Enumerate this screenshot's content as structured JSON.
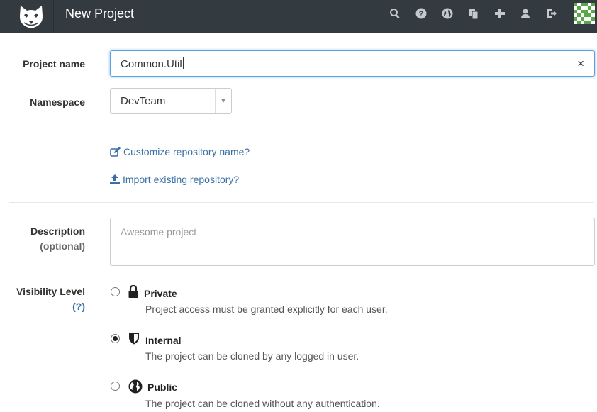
{
  "header": {
    "title": "New Project",
    "icons": [
      "search-icon",
      "help-icon",
      "globe-icon",
      "copy-icon",
      "plus-icon",
      "user-icon",
      "sign-out-icon"
    ],
    "avatar": "avatar"
  },
  "form": {
    "project_name": {
      "label": "Project name",
      "value": "Common.Util",
      "clear": "×"
    },
    "namespace": {
      "label": "Namespace",
      "value": "DevTeam",
      "arrow": "▼"
    },
    "links": {
      "customize": "Customize repository name?",
      "import": "Import existing repository?"
    },
    "description": {
      "label": "Description",
      "sublabel": "(optional)",
      "placeholder": "Awesome project"
    },
    "visibility": {
      "label": "Visibility Level",
      "help": "(?)",
      "options": [
        {
          "title": "Private",
          "desc": "Project access must be granted explicitly for each user.",
          "icon": "lock-icon",
          "checked": false
        },
        {
          "title": "Internal",
          "desc": "The project can be cloned by any logged in user.",
          "icon": "shield-icon",
          "checked": true
        },
        {
          "title": "Public",
          "desc": "The project can be cloned without any authentication.",
          "icon": "globe-icon",
          "checked": false
        }
      ]
    }
  }
}
